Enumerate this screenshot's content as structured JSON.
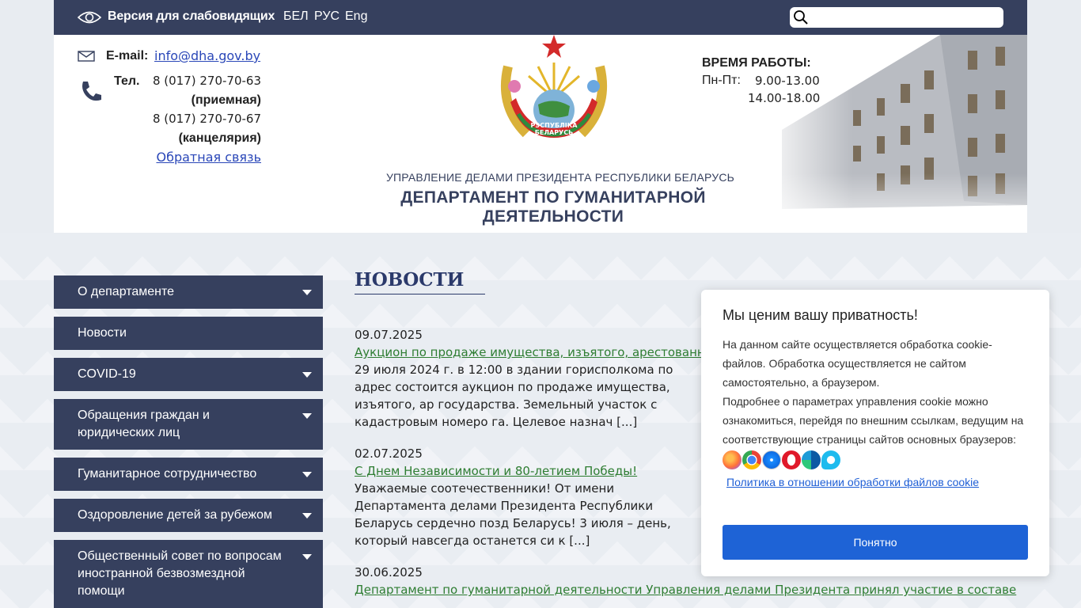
{
  "topbar": {
    "vision_label": "Версия для слабовидящих",
    "langs": [
      "БЕЛ",
      "РУС",
      "Eng"
    ],
    "search_placeholder": ""
  },
  "header": {
    "email_label": "E-mail:",
    "email": "info@dha.gov.by",
    "tel_label": "Тел.",
    "phone1": "8 (017) 270-70-63",
    "phone1_note": "(приемная)",
    "phone2": "8 (017) 270-70-67",
    "phone2_note": "(канцелярия)",
    "feedback": "Обратная связь",
    "org_sub": "УПРАВЛЕНИЕ ДЕЛАМИ ПРЕЗИДЕНТА РЕСПУБЛИКИ БЕЛАРУСЬ",
    "org_main": "ДЕПАРТАМЕНТ ПО ГУМАНИТАРНОЙ ДЕЯТЕЛЬНОСТИ",
    "hours_title": "ВРЕМЯ РАБОТЫ:",
    "hours_days": "Пн-Пт:",
    "hours_t1": "9.00-13.00",
    "hours_t2": "14.00-18.00",
    "emblem_ribbon_text": "РЭСПУБЛІКА БЕЛАРУСЬ"
  },
  "sidebar": {
    "items": [
      {
        "label": "О департаменте",
        "has_sub": true
      },
      {
        "label": "Новости",
        "has_sub": false
      },
      {
        "label": "COVID-19",
        "has_sub": true
      },
      {
        "label": "Обращения граждан и юридических лиц",
        "has_sub": true
      },
      {
        "label": "Гуманитарное сотрудничество",
        "has_sub": true
      },
      {
        "label": "Оздоровление детей за рубежом",
        "has_sub": true
      },
      {
        "label": "Общественный совет по вопросам иностранной безвозмездной помощи",
        "has_sub": true
      }
    ]
  },
  "news": {
    "title": "НОВОСТИ",
    "items": [
      {
        "date": "09.07.2025",
        "title": "Аукцион по продаже имущества, изъятого, арестованно",
        "text": "29 июля 2024 г. в 12:00 в здании горисполкома по адрес состоится аукцион по продаже имущества, изъятого, ар государства. Земельный участок с кадастровым номеро га. Целевое назнач [...]"
      },
      {
        "date": "02.07.2025",
        "title": "С Днем Независимости и 80-летием Победы!",
        "text": "Уважаемые соотечественники!  От имени Департамента делами Президента Республики Беларусь сердечно позд Беларусь! 3 июля – день, который навсегда останется си к [...]"
      },
      {
        "date": "30.06.2025",
        "title": "Департамент по гуманитарной деятельности Управления делами Президента принял участие в составе",
        "text": ""
      }
    ]
  },
  "cookie": {
    "title": "Мы ценим вашу приватность!",
    "text1": "На данном сайте осуществляется обработка cookie-файлов. Обработка осуществляется не сайтом самостоятельно, а браузером.",
    "text2": "Подробнее о параметрах управления cookie можно ознакомиться, перейдя по внешним ссылкам, ведущим на соответствующие страницы сайтов основных браузеров:",
    "browsers": [
      "firefox-icon",
      "chrome-icon",
      "safari-icon",
      "opera-icon",
      "edge-icon",
      "ie-icon"
    ],
    "policy": "Политика в отношении обработки файлов cookie",
    "button": "Понятно"
  },
  "colors": {
    "navy": "#36405e",
    "link_green": "#2e7d32",
    "link_blue": "#2a47b8",
    "cookie_button": "#1e63d6"
  }
}
